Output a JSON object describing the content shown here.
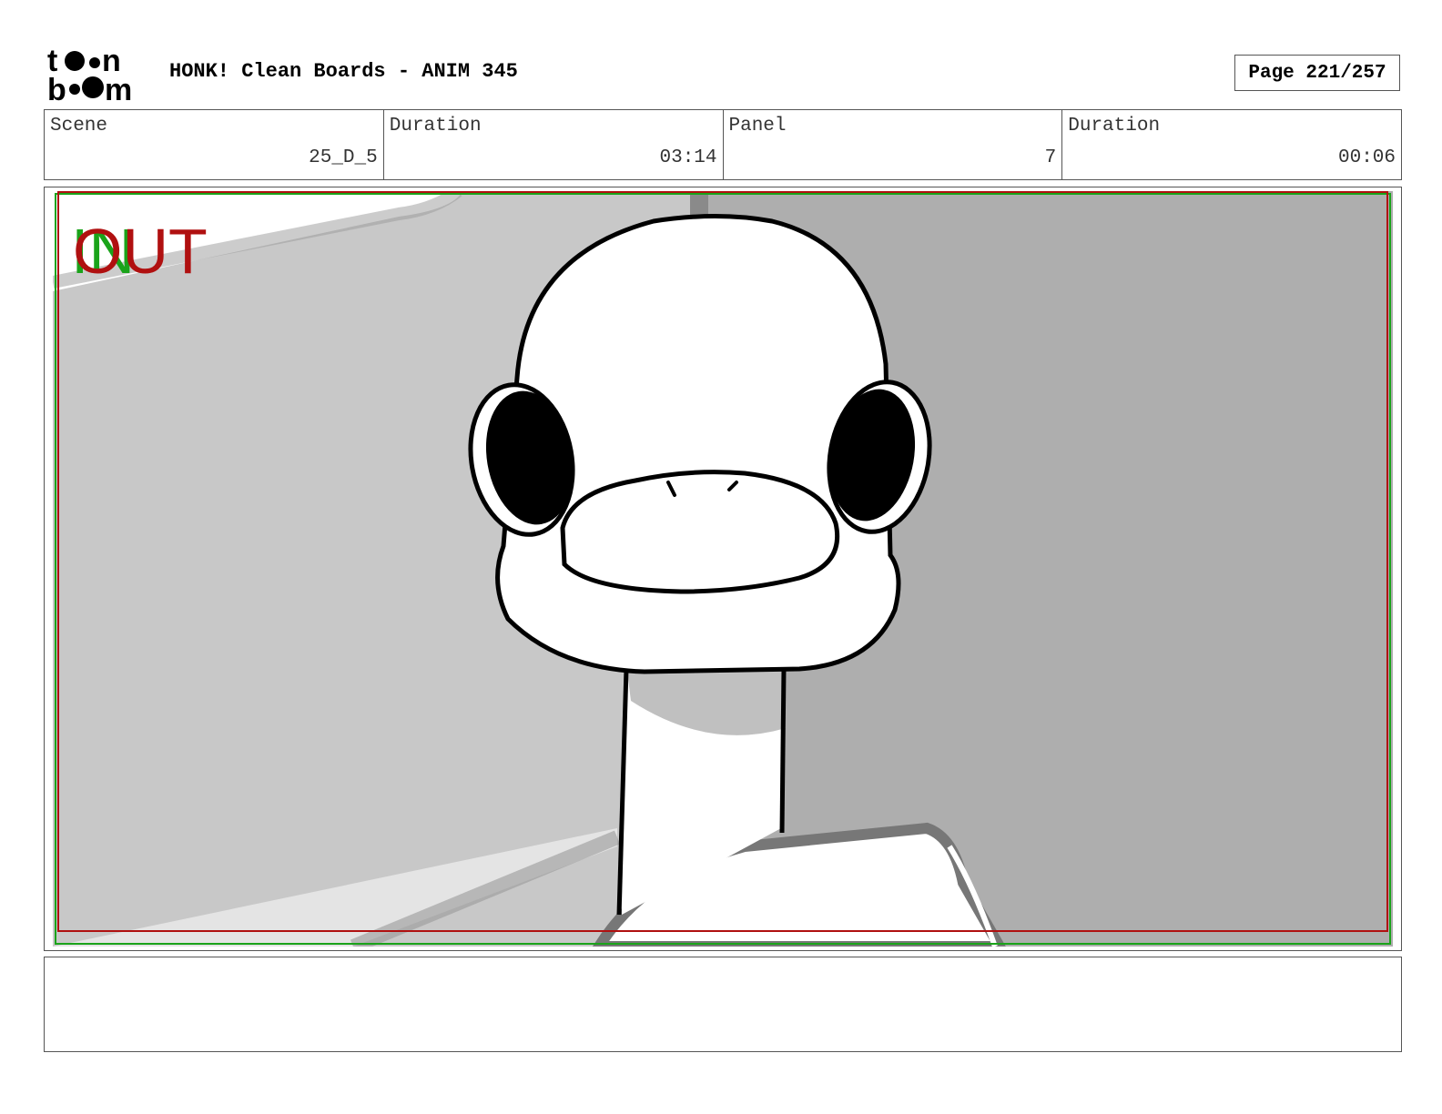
{
  "header": {
    "logo_text_top": "toon",
    "logo_text_bottom": "boom",
    "title": "HONK! Clean Boards - ANIM 345",
    "page_label": "Page 221/257"
  },
  "info": [
    {
      "label": "Scene",
      "value": "25_D_5"
    },
    {
      "label": "Duration",
      "value": "03:14"
    },
    {
      "label": "Panel",
      "value": "7"
    },
    {
      "label": "Duration",
      "value": "00:06"
    }
  ],
  "panel": {
    "in_marker": "IN",
    "out_marker": "OUT",
    "in_color": "#1aa31a",
    "out_color": "#b01010"
  },
  "notes": {
    "text": ""
  }
}
